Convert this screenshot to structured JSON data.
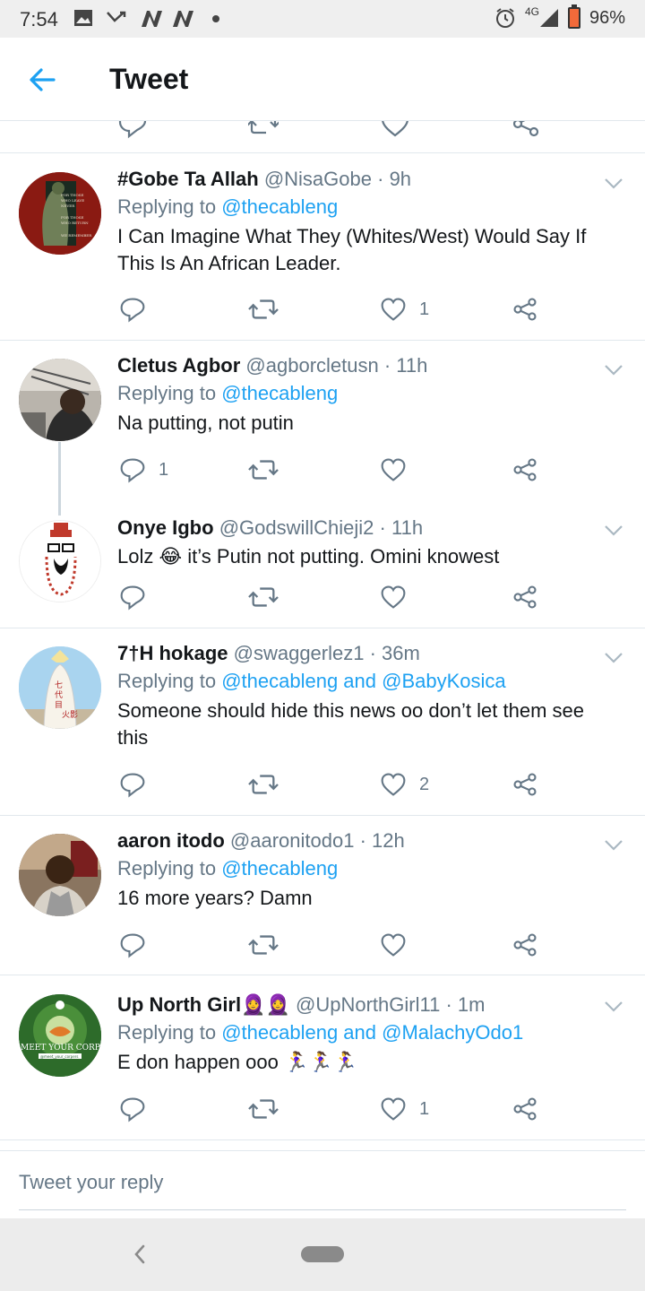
{
  "status": {
    "time": "7:54",
    "network": "4G",
    "battery": "96%"
  },
  "header": {
    "title": "Tweet"
  },
  "tweets": [
    {
      "name": "#Gobe Ta Allah",
      "handle": "@NisaGobe",
      "time": "· 9h",
      "reply_prefix": "Replying to",
      "reply_to": "@thecableng",
      "text": "I Can Imagine What They (Whites/West) Would Say If This Is An African Leader.",
      "reply_count": "",
      "like_count": "1"
    },
    {
      "name": "Cletus Agbor",
      "handle": "@agborcletusn",
      "time": "· 11h",
      "reply_prefix": "Replying to",
      "reply_to": "@thecableng",
      "text": "Na putting, not putin",
      "reply_count": "1",
      "like_count": ""
    },
    {
      "name": "Onye Igbo",
      "handle": "@GodswillChieji2",
      "time": "· 11h",
      "text": "Lolz 😂 it’s Putin not putting. Omini knowest",
      "reply_count": "",
      "like_count": ""
    },
    {
      "name": "7†H hokage",
      "handle": "@swaggerlez1",
      "time": "· 36m",
      "reply_prefix": "Replying to",
      "reply_to": "@thecableng and @BabyKosica",
      "text": "Someone should hide this news oo don’t let them see this",
      "reply_count": "",
      "like_count": "2"
    },
    {
      "name": "aaron itodo",
      "handle": "@aaronitodo1",
      "time": "· 12h",
      "reply_prefix": "Replying to",
      "reply_to": "@thecableng",
      "text": "16 more years? Damn",
      "reply_count": "",
      "like_count": ""
    },
    {
      "name": "Up North Girl🧕🧕",
      "handle": "@UpNorthGirl11",
      "time": "· 1m",
      "reply_prefix": "Replying to",
      "reply_to": "@thecableng and @MalachyOdo1",
      "text": "E don happen ooo 🏃‍♀️🏃‍♀️🏃‍♀️",
      "reply_count": "",
      "like_count": "1"
    }
  ],
  "avatars": {
    "gobe_text": "FOR THOSE WHO LEAVE NEVER TO RETURN · FOR THOSE WHO RETURN BUT ARE NEVER THE SAME · WE REMEMBER",
    "hokage_text": "七代目火影",
    "upnorth_text": "MEET YOUR CORP",
    "upnorth_sub": "@meet_your_corpers"
  },
  "composer": {
    "placeholder": "Tweet your reply"
  },
  "colors": {
    "accent": "#1da1f2",
    "muted": "#657786",
    "divider": "#e1e8ed"
  }
}
